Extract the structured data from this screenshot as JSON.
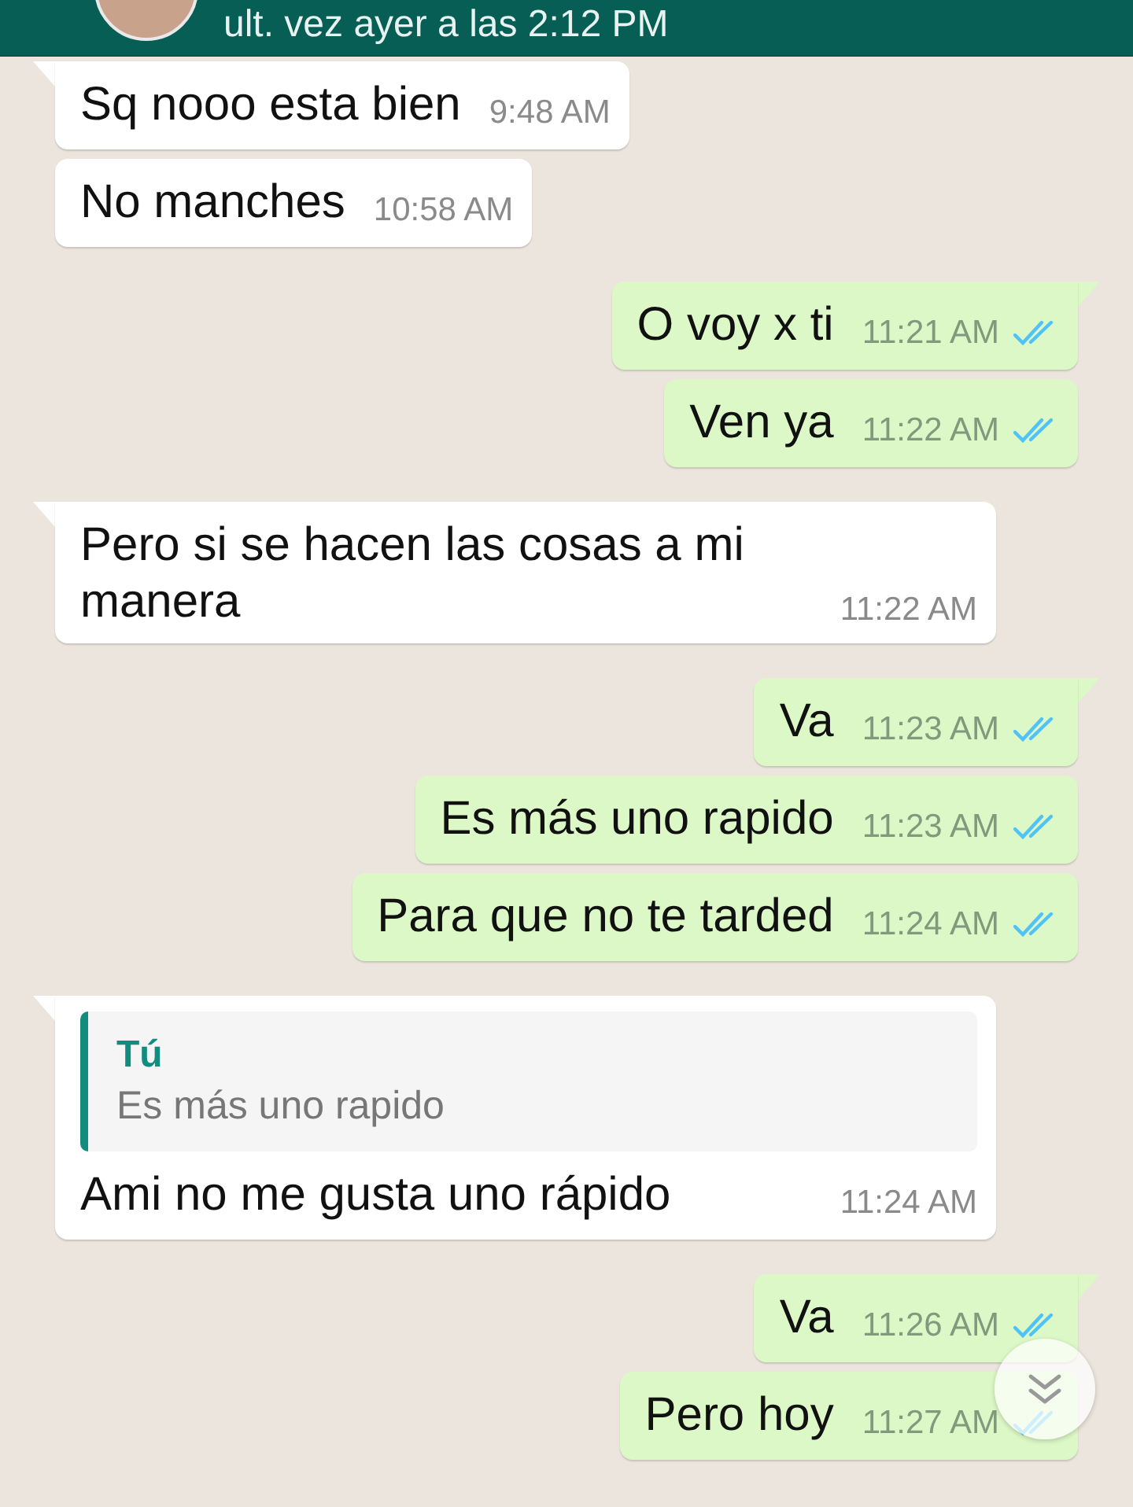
{
  "header": {
    "status": "ult. vez ayer a las 2:12 PM"
  },
  "messages": [
    {
      "kind": "received",
      "tail": true,
      "text": "Sq nooo esta bien",
      "time": "9:48 AM"
    },
    {
      "kind": "received",
      "tail": false,
      "text": "No manches",
      "time": "10:58 AM"
    },
    {
      "kind": "sent",
      "tail": true,
      "text": "O voy x ti",
      "time": "11:21 AM",
      "read": true
    },
    {
      "kind": "sent",
      "tail": false,
      "text": "Ven ya",
      "time": "11:22 AM",
      "read": true
    },
    {
      "kind": "received",
      "tail": true,
      "text": "Pero si se hacen las cosas a mi manera",
      "time": "11:22 AM"
    },
    {
      "kind": "sent",
      "tail": true,
      "text": "Va",
      "time": "11:23 AM",
      "read": true
    },
    {
      "kind": "sent",
      "tail": false,
      "text": "Es más uno rapido",
      "time": "11:23 AM",
      "read": true
    },
    {
      "kind": "sent",
      "tail": false,
      "text": "Para que no te tarded",
      "time": "11:24 AM",
      "read": true
    },
    {
      "kind": "received",
      "tail": true,
      "quote": {
        "author": "Tú",
        "text": "Es más uno rapido"
      },
      "text": "Ami no me gusta uno rápido",
      "time": "11:24 AM"
    },
    {
      "kind": "sent",
      "tail": true,
      "text": "Va",
      "time": "11:26 AM",
      "read": true
    },
    {
      "kind": "sent",
      "tail": false,
      "text": "Pero hoy",
      "time": "11:27 AM",
      "read": true
    }
  ]
}
